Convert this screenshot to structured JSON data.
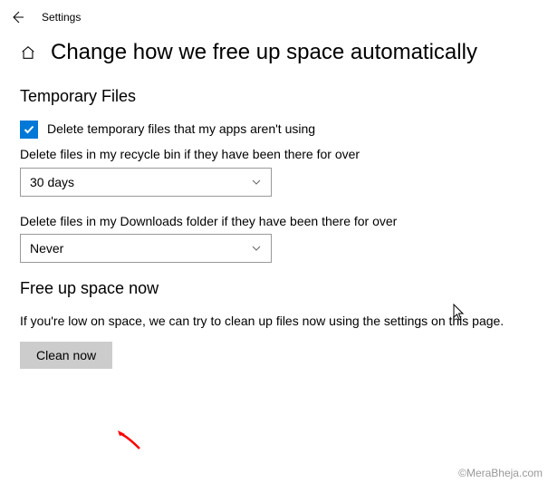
{
  "header": {
    "title": "Settings"
  },
  "page": {
    "title": "Change how we free up space automatically"
  },
  "temp_files": {
    "heading": "Temporary Files",
    "checkbox_label": "Delete temporary files that my apps aren't using",
    "recycle_label": "Delete files in my recycle bin if they have been there for over",
    "recycle_value": "30 days",
    "downloads_label": "Delete files in my Downloads folder if they have been there for over",
    "downloads_value": "Never"
  },
  "free_up": {
    "heading": "Free up space now",
    "description": "If you're low on space, we can try to clean up files now using the settings on this page.",
    "button": "Clean now"
  },
  "watermark": "©MeraBheja.com"
}
